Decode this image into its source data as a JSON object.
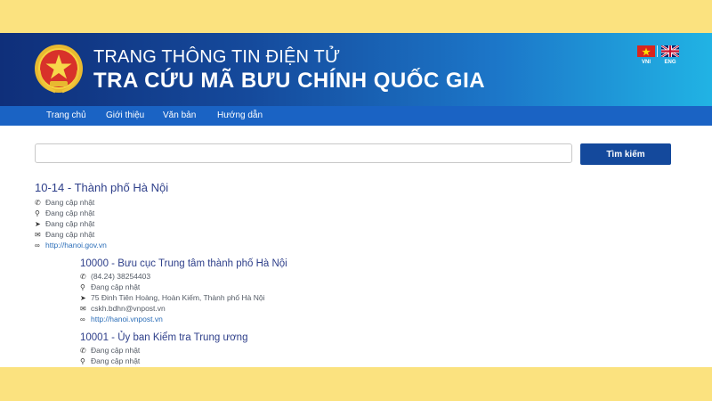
{
  "header": {
    "subtitle": "TRANG THÔNG TIN ĐIỆN TỬ",
    "title": "TRA CỨU MÃ BƯU CHÍNH QUỐC GIA",
    "lang_vn": "VNI",
    "lang_en": "ENG"
  },
  "nav": {
    "items": [
      "Trang chủ",
      "Giới thiệu",
      "Văn bản",
      "Hướng dẫn"
    ]
  },
  "search": {
    "value": "",
    "button_label": "Tìm kiếm"
  },
  "results": [
    {
      "title": "10-14 - Thành phố Hà Nội",
      "phone": "Đang cập nhật",
      "location": "Đang cập nhật",
      "address": "Đang cập nhật",
      "email": "Đang cập nhật",
      "website": "http://hanoi.gov.vn"
    },
    {
      "title": "10000 - Bưu cục Trung tâm thành phố Hà Nội",
      "phone": "(84.24) 38254403",
      "location": "Đang cập nhật",
      "address": "75 Đinh Tiên Hoàng, Hoàn Kiếm, Thành phố Hà Nội",
      "email": "cskh.bdhn@vnpost.vn",
      "website": "http://hanoi.vnpost.vn"
    },
    {
      "title": "10001 - Ủy ban Kiểm tra Trung ương",
      "phone": "Đang cập nhật",
      "location": "Đang cập nhật"
    }
  ],
  "icons": {
    "phone": "phone-icon",
    "location": "map-marker-icon",
    "address": "location-arrow-icon",
    "email": "envelope-icon",
    "website": "link-icon"
  },
  "colors": {
    "page_background": "#fbe27f",
    "banner_start": "#0f2f7a",
    "banner_end": "#21b3e4",
    "nav": "#1a63c4",
    "button": "#14499c",
    "result_title": "#2e3f8a",
    "link": "#2a6db8"
  }
}
